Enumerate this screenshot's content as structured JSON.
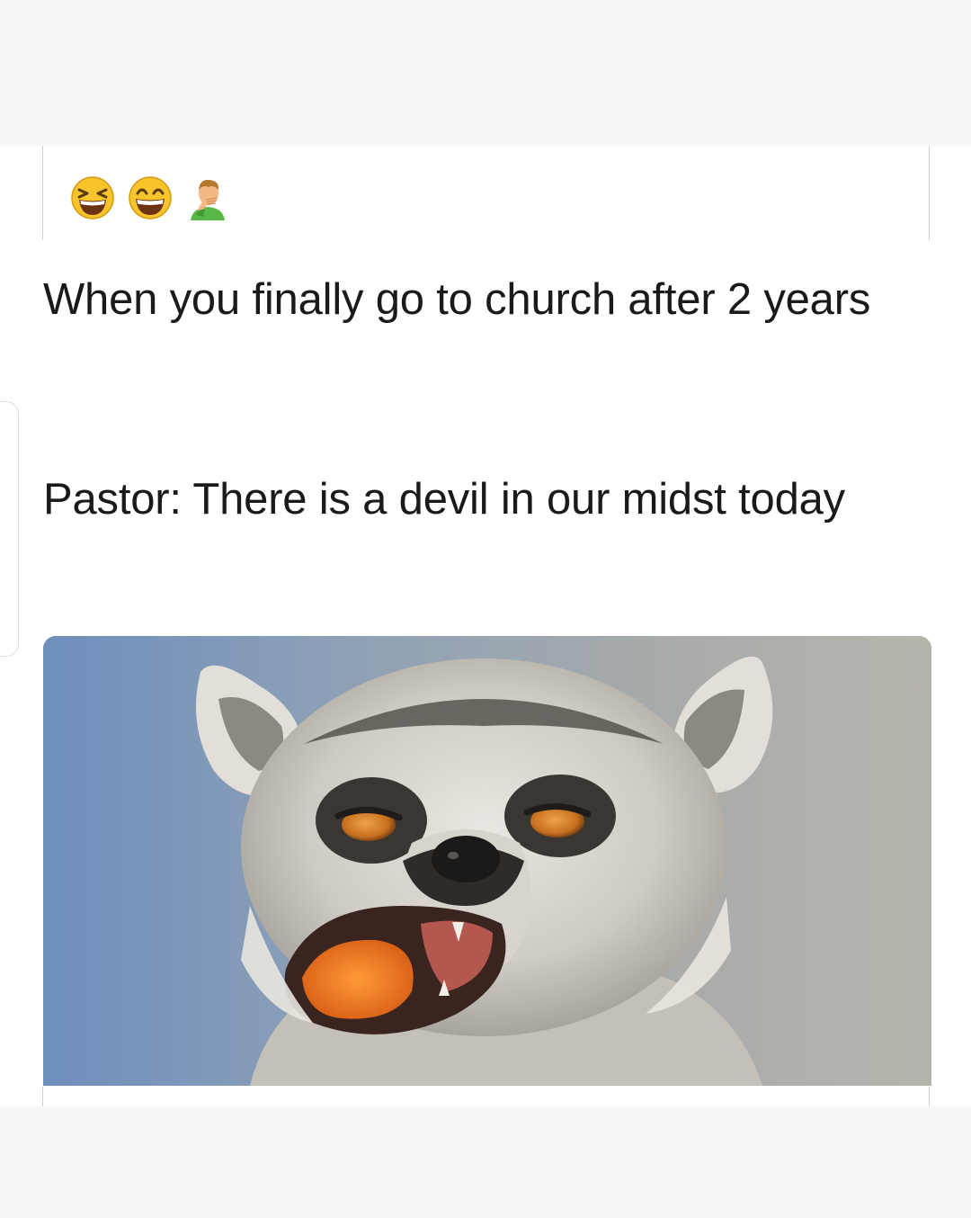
{
  "post": {
    "emojis": [
      "grinning-squinting-face-icon",
      "grinning-face-with-smiling-eyes-icon",
      "man-facepalming-icon"
    ],
    "caption_line_1": "When you finally go to church after 2 years",
    "caption_line_2": "Pastor: There is a devil in our midst today",
    "image": "lemur-open-mouth-photo"
  },
  "colors": {
    "background": "#f7f7f7",
    "card": "#ffffff",
    "text": "#1a1a1a",
    "emoji_yellow": "#f7c52b",
    "lemur_eye": "#d9822b",
    "food_orange": "#f07a1c"
  }
}
